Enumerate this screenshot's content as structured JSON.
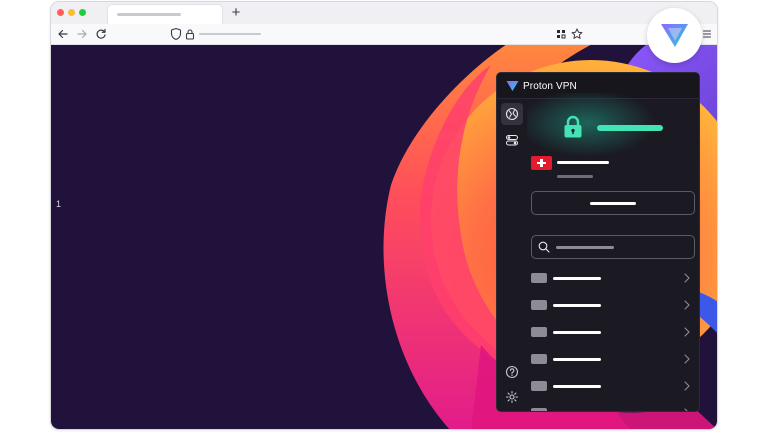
{
  "browser": {
    "tabs": [
      {
        "label": ""
      }
    ],
    "new_tab_label": "+",
    "traffic_lights": [
      "#ff5f57",
      "#febc2e",
      "#28c840"
    ],
    "address": ""
  },
  "page": {
    "background": "#20123a",
    "marker_text": "1"
  },
  "extension": {
    "brand_name": "Proton VPN",
    "colors": {
      "accent_green": "#43e3b3",
      "panel_bg": "#1b1a22",
      "brand_purple": "#6d4aff"
    },
    "sidebar": [
      {
        "icon": "globe-icon",
        "active": true
      },
      {
        "icon": "toggles-icon",
        "active": false
      }
    ],
    "sidebar_bottom": [
      {
        "icon": "help-icon"
      },
      {
        "icon": "settings-icon"
      }
    ],
    "status_icon": "lock-icon",
    "server_flag": "switzerland-flag-icon",
    "server_list_rows": 6
  }
}
